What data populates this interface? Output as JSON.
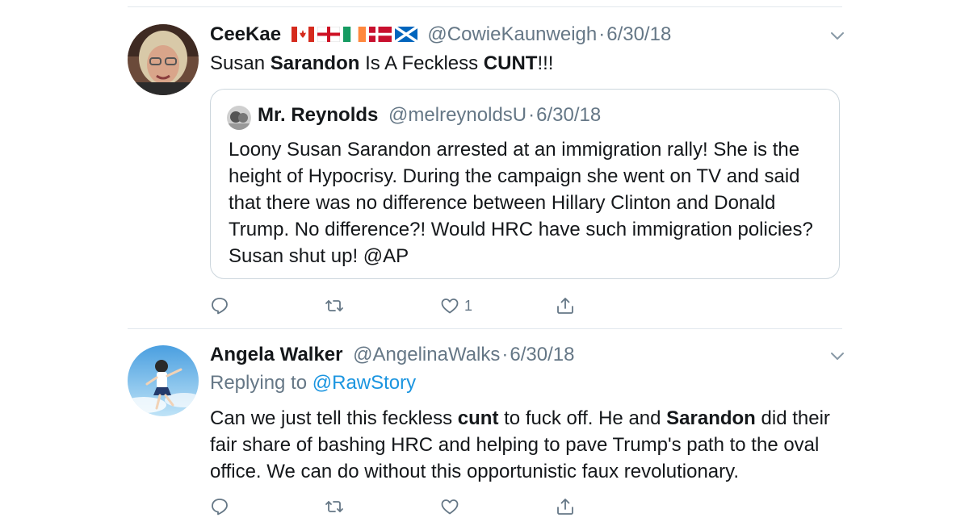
{
  "tweets": [
    {
      "display_name": "CeeKae",
      "flags": [
        "canada-flag",
        "england-flag",
        "ireland-flag",
        "denmark-flag",
        "scotland-flag"
      ],
      "handle": "@CowieKaunweigh",
      "separator": "·",
      "date": "6/30/18",
      "text": {
        "t1": "Susan ",
        "b1": "Sarandon",
        "t2": " Is A Feckless ",
        "b2": "CUNT",
        "t3": "!!!"
      },
      "quote": {
        "display_name": "Mr. Reynolds",
        "handle": "@melreynoldsU",
        "separator": "·",
        "date": "6/30/18",
        "text": "Loony Susan Sarandon arrested at an immigration rally! She is the height of Hypocrisy. During the campaign she went on TV and said that there was no difference between Hillary Clinton and Donald Trump. No difference?! Would HRC have such immigration policies? Susan shut up! @AP"
      },
      "actions": {
        "reply_count": "",
        "retweet_count": "",
        "like_count": "1"
      }
    },
    {
      "display_name": "Angela Walker",
      "handle": "@AngelinaWalks",
      "separator": "·",
      "date": "6/30/18",
      "replying_label": "Replying to ",
      "replying_to": "@RawStory",
      "text": {
        "t1": "Can we just tell this feckless ",
        "b1": "cunt",
        "t2": " to fuck off.  He and ",
        "b2": "Sarandon",
        "t3": " did their fair share of bashing HRC and helping to pave Trump's path to the oval office.  We can do without this opportunistic faux revolutionary."
      },
      "actions": {
        "reply_count": "",
        "retweet_count": "",
        "like_count": ""
      }
    }
  ],
  "icons": {
    "reply": "reply-icon",
    "retweet": "retweet-icon",
    "like": "heart-icon",
    "share": "share-icon",
    "menu": "chevron-down-icon"
  },
  "colors": {
    "text": "#14171a",
    "muted": "#657786",
    "link": "#1b95e0",
    "border": "#e1e8ed"
  }
}
